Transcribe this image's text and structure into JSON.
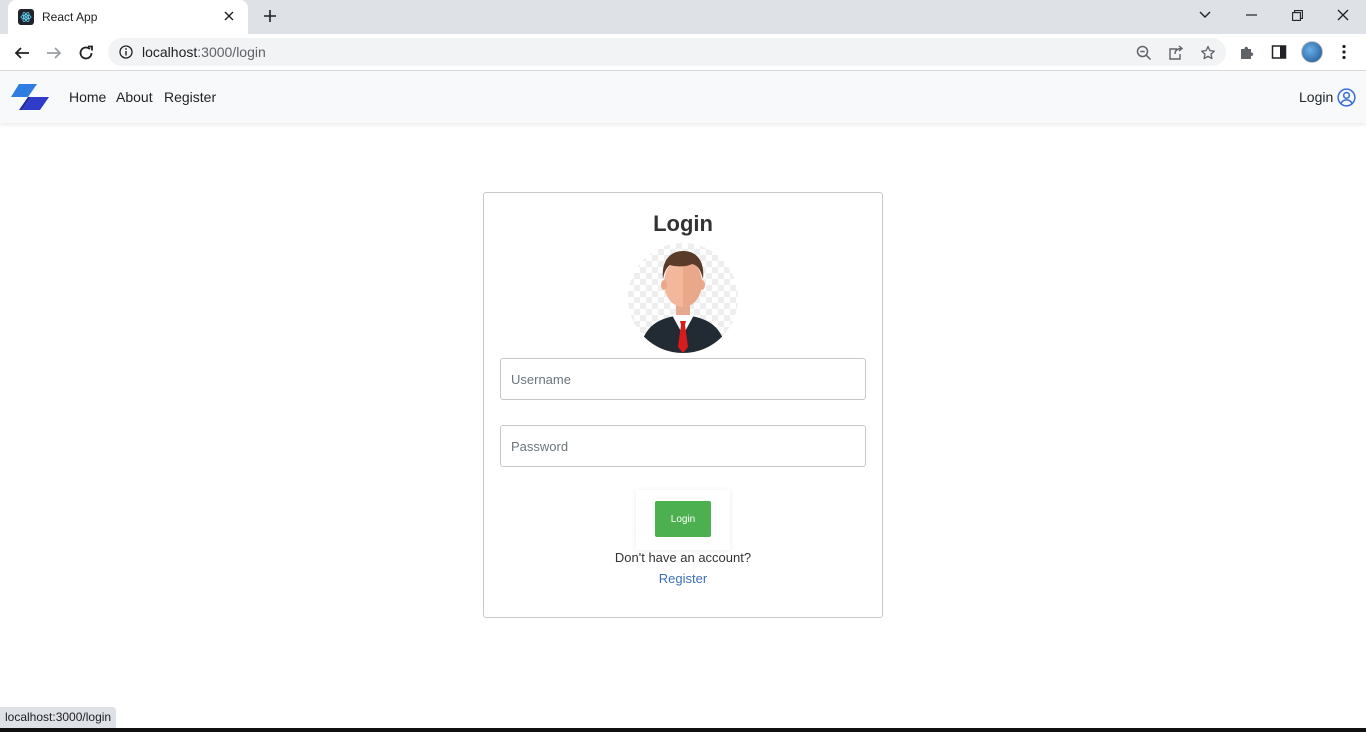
{
  "browser": {
    "tab_title": "React App",
    "url_host": "localhost",
    "url_path": ":3000/login",
    "status_url": "localhost:3000/login",
    "icons": [
      "react-favicon",
      "close-icon",
      "plus-icon",
      "chevron-down-icon",
      "minimize-icon",
      "restore-icon",
      "close-window-icon",
      "back-icon",
      "forward-icon",
      "reload-icon",
      "info-icon",
      "zoom-icon",
      "share-icon",
      "star-icon",
      "extensions-icon",
      "sidepanel-icon",
      "profile-avatar",
      "menu-icon"
    ]
  },
  "navbar": {
    "links": [
      "Home",
      "About",
      "Register"
    ],
    "login_label": "Login",
    "icons": [
      "brand-logo",
      "user-circle-icon"
    ]
  },
  "login_card": {
    "title": "Login",
    "username_placeholder": "Username",
    "password_placeholder": "Password",
    "submit_label": "Login",
    "no_account_text": "Don't have an account?",
    "register_link": "Register"
  },
  "colors": {
    "button_green": "#4caf50",
    "link_blue": "#3d6fb6",
    "brand_blue": "#2f3cc9"
  }
}
